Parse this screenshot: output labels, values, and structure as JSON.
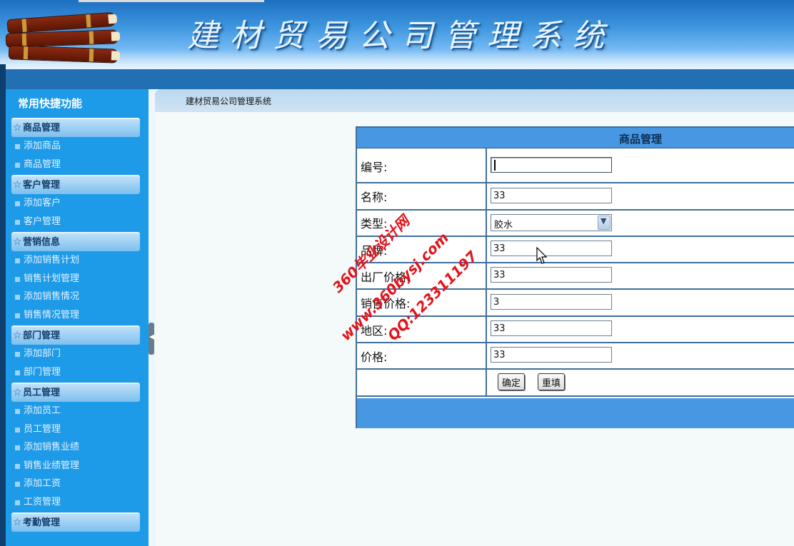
{
  "header": {
    "title": "建材贸易公司管理系统"
  },
  "sidebar": {
    "title": "常用快捷功能",
    "sections": [
      {
        "label": "商品管理",
        "items": [
          "添加商品",
          "商品管理"
        ]
      },
      {
        "label": "客户管理",
        "items": [
          "添加客户",
          "客户管理"
        ]
      },
      {
        "label": "营销信息",
        "items": [
          "添加销售计划",
          "销售计划管理",
          "添加销售情况",
          "销售情况管理"
        ]
      },
      {
        "label": "部门管理",
        "items": [
          "添加部门",
          "部门管理"
        ]
      },
      {
        "label": "员工管理",
        "items": [
          "添加员工",
          "员工管理",
          "添加销售业绩",
          "销售业绩管理",
          "添加工资",
          "工资管理"
        ]
      },
      {
        "label": "考勤管理",
        "items": []
      }
    ]
  },
  "breadcrumb": "建材贸易公司管理系统",
  "form": {
    "heading": "商品管理",
    "fields": {
      "id": {
        "label": "编号:",
        "value": ""
      },
      "name": {
        "label": "名称:",
        "value": "33"
      },
      "type": {
        "label": "类型:",
        "value": "胶水"
      },
      "brand": {
        "label": "品牌:",
        "value": "33"
      },
      "factory_price": {
        "label": "出厂价格:",
        "value": "33"
      },
      "sale_price": {
        "label": "销售价格:",
        "value": "3"
      },
      "region": {
        "label": "地区:",
        "value": "33"
      },
      "price": {
        "label": "价格:",
        "value": "33"
      }
    },
    "submit_label": "确定",
    "reset_label": "重填"
  },
  "watermark": {
    "line1": "360毕业设计网",
    "line2": "www.360bysj.com",
    "line3": "QQ:123311197",
    "color": "#e3131b"
  }
}
